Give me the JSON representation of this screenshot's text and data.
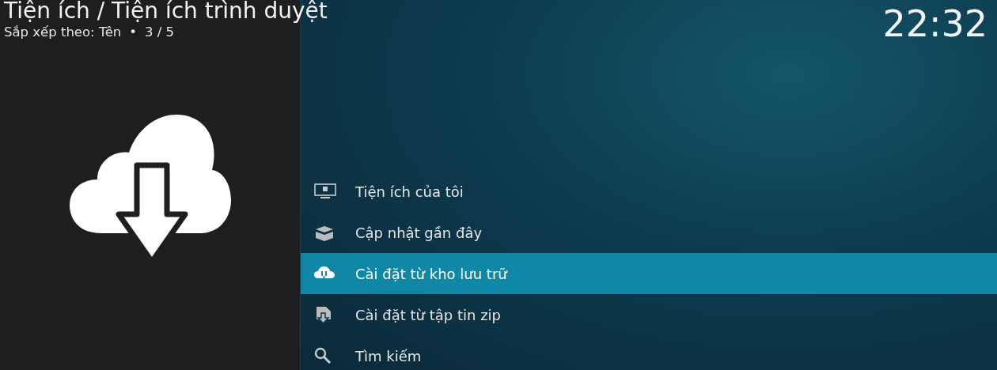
{
  "header": {
    "title": "Tiện ích / Tiện ích trình duyệt",
    "sort_label": "Sắp xếp theo: Tên",
    "separator": "•",
    "position": "3 / 5",
    "clock": "22:32"
  },
  "menu": [
    {
      "label": "Tiện ích của tôi",
      "selected": false
    },
    {
      "label": "Cập nhật gần đây",
      "selected": false
    },
    {
      "label": "Cài đặt từ kho lưu trữ",
      "selected": true
    },
    {
      "label": "Cài đặt từ tập tin zip",
      "selected": false
    },
    {
      "label": "Tìm kiếm",
      "selected": false
    }
  ]
}
